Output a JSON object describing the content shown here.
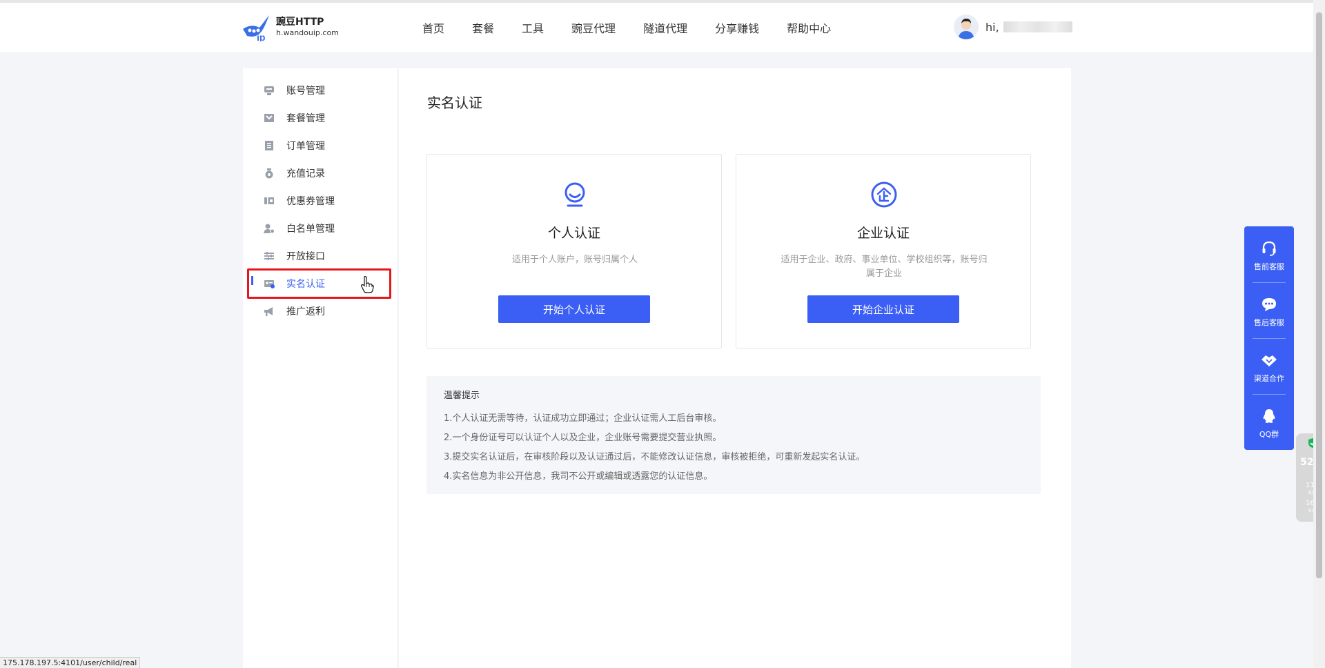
{
  "header": {
    "logo": {
      "title": "豌豆HTTP",
      "subtitle": "h.wandouip.com",
      "icon": "wandou-logo-icon"
    },
    "nav": [
      {
        "label": "首页"
      },
      {
        "label": "套餐"
      },
      {
        "label": "工具"
      },
      {
        "label": "豌豆代理"
      },
      {
        "label": "隧道代理"
      },
      {
        "label": "分享赚钱"
      },
      {
        "label": "帮助中心"
      }
    ],
    "user": {
      "greeting": "hi,"
    }
  },
  "sidebar": {
    "items": [
      {
        "label": "账号管理",
        "icon": "account-icon"
      },
      {
        "label": "套餐管理",
        "icon": "package-icon"
      },
      {
        "label": "订单管理",
        "icon": "order-icon"
      },
      {
        "label": "充值记录",
        "icon": "recharge-icon"
      },
      {
        "label": "优惠券管理",
        "icon": "coupon-icon"
      },
      {
        "label": "白名单管理",
        "icon": "whitelist-icon"
      },
      {
        "label": "开放接口",
        "icon": "api-icon"
      },
      {
        "label": "实名认证",
        "icon": "id-card-icon",
        "active": true
      },
      {
        "label": "推广返利",
        "icon": "megaphone-icon"
      }
    ],
    "active_color": "#3b5ff5"
  },
  "main": {
    "title": "实名认证",
    "cards": [
      {
        "title": "个人认证",
        "desc": "适用于个人账户，账号归属个人",
        "button": "开始个人认证",
        "icon": "person-icon"
      },
      {
        "title": "企业认证",
        "desc": "适用于企业、政府、事业单位、学校组织等，账号归属于企业",
        "button": "开始企业认证",
        "icon": "enterprise-icon"
      }
    ],
    "tips": {
      "title": "温馨提示",
      "lines": [
        "1.个人认证无需等待，认证成功立即通过；企业认证需人工后台审核。",
        "2.一个身份证号可以认证个人以及企业，企业账号需要提交营业执照。",
        "3.提交实名认证后，在审核阶段以及认证通过后，不能修改认证信息，审核被拒绝，可重新发起实名认证。",
        "4.实名信息为非公开信息，我司不公开或编辑或透露您的认证信息。"
      ]
    }
  },
  "float_panel": {
    "items": [
      {
        "label": "售前客服",
        "icon": "headset-icon"
      },
      {
        "label": "售后客服",
        "icon": "chat-icon"
      },
      {
        "label": "渠道合作",
        "icon": "handshake-icon"
      },
      {
        "label": "QQ群",
        "icon": "qq-icon"
      }
    ],
    "color": "#3b5ff5"
  },
  "widget": {
    "percent": "52",
    "upload": "11.1",
    "download": "16.5",
    "unit": "K/s"
  },
  "status_url": "175.178.197.5:4101/user/child/real"
}
